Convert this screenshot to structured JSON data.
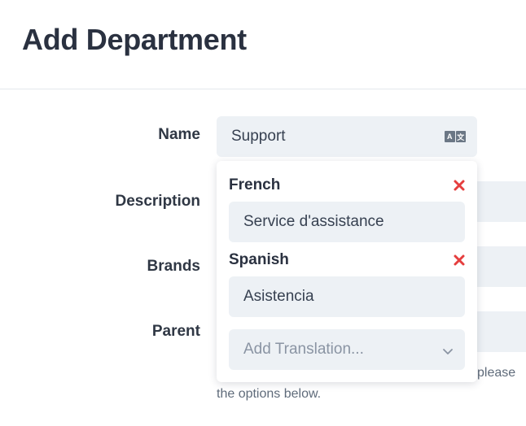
{
  "page": {
    "title": "Add Department"
  },
  "form": {
    "name_label": "Name",
    "name_value": "Support",
    "translate_icon": "translate-icon",
    "translate_glyphs": [
      "A",
      "文"
    ],
    "description_label": "Description",
    "brands_label": "Brands",
    "parent_label": "Parent",
    "helper_tail": "please",
    "helper_line2": "the options below."
  },
  "translations": {
    "items": [
      {
        "language": "French",
        "value": "Service d'assistance"
      },
      {
        "language": "Spanish",
        "value": "Asistencia"
      }
    ],
    "remove_icon": "close-icon",
    "add_placeholder": "Add Translation...",
    "chevron_icon": "chevron-down-icon"
  },
  "colors": {
    "remove": "#e53e3e",
    "field_bg": "#edf1f5"
  }
}
